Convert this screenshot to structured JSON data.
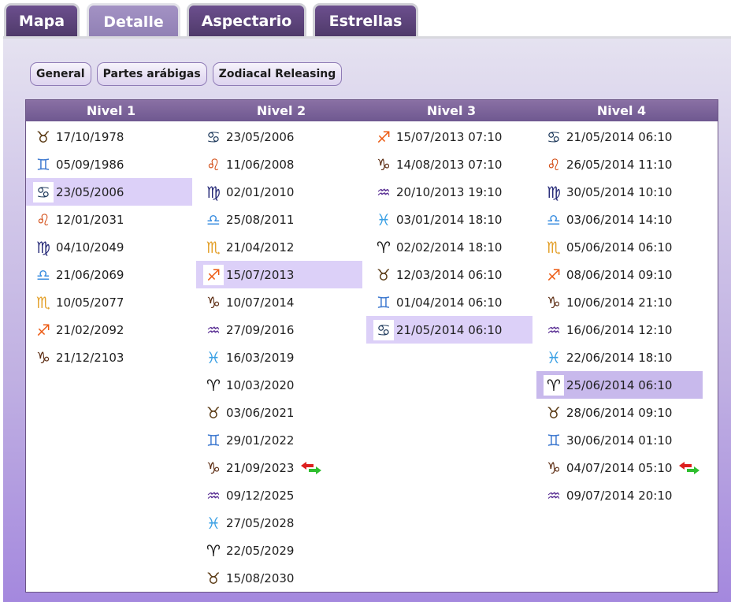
{
  "tabs": [
    {
      "label": "Mapa",
      "active": false
    },
    {
      "label": "Detalle",
      "active": true
    },
    {
      "label": "Aspectario",
      "active": false
    },
    {
      "label": "Estrellas",
      "active": false
    }
  ],
  "subtabs": [
    "General",
    "Partes arábigas",
    "Zodiacal Releasing"
  ],
  "headers": [
    "Nivel 1",
    "Nivel 2",
    "Nivel 3",
    "Nivel 4"
  ],
  "signs": {
    "aries": {
      "glyph": "♈",
      "color": "#1a1a1a"
    },
    "taurus": {
      "glyph": "♉",
      "color": "#5a3a14"
    },
    "gemini": {
      "glyph": "♊",
      "color": "#3f7ad0"
    },
    "cancer": {
      "glyph": "♋",
      "color": "#1f3a5c"
    },
    "leo": {
      "glyph": "♌",
      "color": "#d2480f"
    },
    "virgo": {
      "glyph": "♍",
      "color": "#272b78"
    },
    "libra": {
      "glyph": "♎",
      "color": "#3d8fe0"
    },
    "scorpio": {
      "glyph": "♏",
      "color": "#e3a02a"
    },
    "sagittarius": {
      "glyph": "♐",
      "color": "#ec5a12"
    },
    "capricorn": {
      "glyph": "♑",
      "color": "#5c2c12"
    },
    "aquarius": {
      "glyph": "♒",
      "color": "#5a3094"
    },
    "pisces": {
      "glyph": "♓",
      "color": "#3aa0e4"
    }
  },
  "colors": {
    "arrow_red": "#dd1f1f",
    "arrow_green": "#2fbe2f"
  },
  "columns": [
    [
      {
        "sign": "taurus",
        "date": "17/10/1978"
      },
      {
        "sign": "gemini",
        "date": "05/09/1986"
      },
      {
        "sign": "cancer",
        "date": "23/05/2006",
        "selected": true
      },
      {
        "sign": "leo",
        "date": "12/01/2031"
      },
      {
        "sign": "virgo",
        "date": "04/10/2049"
      },
      {
        "sign": "libra",
        "date": "21/06/2069"
      },
      {
        "sign": "scorpio",
        "date": "10/05/2077"
      },
      {
        "sign": "sagittarius",
        "date": "21/02/2092"
      },
      {
        "sign": "capricorn",
        "date": "21/12/2103"
      }
    ],
    [
      {
        "sign": "cancer",
        "date": "23/05/2006"
      },
      {
        "sign": "leo",
        "date": "11/06/2008"
      },
      {
        "sign": "virgo",
        "date": "02/01/2010"
      },
      {
        "sign": "libra",
        "date": "25/08/2011"
      },
      {
        "sign": "scorpio",
        "date": "21/04/2012"
      },
      {
        "sign": "sagittarius",
        "date": "15/07/2013",
        "selected": true
      },
      {
        "sign": "capricorn",
        "date": "10/07/2014"
      },
      {
        "sign": "aquarius",
        "date": "27/09/2016"
      },
      {
        "sign": "pisces",
        "date": "16/03/2019"
      },
      {
        "sign": "aries",
        "date": "10/03/2020"
      },
      {
        "sign": "taurus",
        "date": "03/06/2021"
      },
      {
        "sign": "gemini",
        "date": "29/01/2022"
      },
      {
        "sign": "capricorn",
        "date": "21/09/2023",
        "arrows": true
      },
      {
        "sign": "aquarius",
        "date": "09/12/2025"
      },
      {
        "sign": "pisces",
        "date": "27/05/2028"
      },
      {
        "sign": "aries",
        "date": "22/05/2029"
      },
      {
        "sign": "taurus",
        "date": "15/08/2030"
      }
    ],
    [
      {
        "sign": "sagittarius",
        "date": "15/07/2013 07:10"
      },
      {
        "sign": "capricorn",
        "date": "14/08/2013 07:10"
      },
      {
        "sign": "aquarius",
        "date": "20/10/2013 19:10"
      },
      {
        "sign": "pisces",
        "date": "03/01/2014 18:10"
      },
      {
        "sign": "aries",
        "date": "02/02/2014 18:10"
      },
      {
        "sign": "taurus",
        "date": "12/03/2014 06:10"
      },
      {
        "sign": "gemini",
        "date": "01/04/2014 06:10"
      },
      {
        "sign": "cancer",
        "date": "21/05/2014 06:10",
        "selected": true
      }
    ],
    [
      {
        "sign": "cancer",
        "date": "21/05/2014 06:10"
      },
      {
        "sign": "leo",
        "date": "26/05/2014 11:10"
      },
      {
        "sign": "virgo",
        "date": "30/05/2014 10:10"
      },
      {
        "sign": "libra",
        "date": "03/06/2014 14:10"
      },
      {
        "sign": "scorpio",
        "date": "05/06/2014 06:10"
      },
      {
        "sign": "sagittarius",
        "date": "08/06/2014 09:10"
      },
      {
        "sign": "capricorn",
        "date": "10/06/2014 21:10"
      },
      {
        "sign": "aquarius",
        "date": "16/06/2014 12:10"
      },
      {
        "sign": "pisces",
        "date": "22/06/2014 18:10"
      },
      {
        "sign": "aries",
        "date": "25/06/2014 06:10",
        "selected": true,
        "dark": true
      },
      {
        "sign": "taurus",
        "date": "28/06/2014 09:10"
      },
      {
        "sign": "gemini",
        "date": "30/06/2014 01:10"
      },
      {
        "sign": "capricorn",
        "date": "04/07/2014 05:10",
        "arrows": true
      },
      {
        "sign": "aquarius",
        "date": "09/07/2014 20:10"
      }
    ]
  ]
}
